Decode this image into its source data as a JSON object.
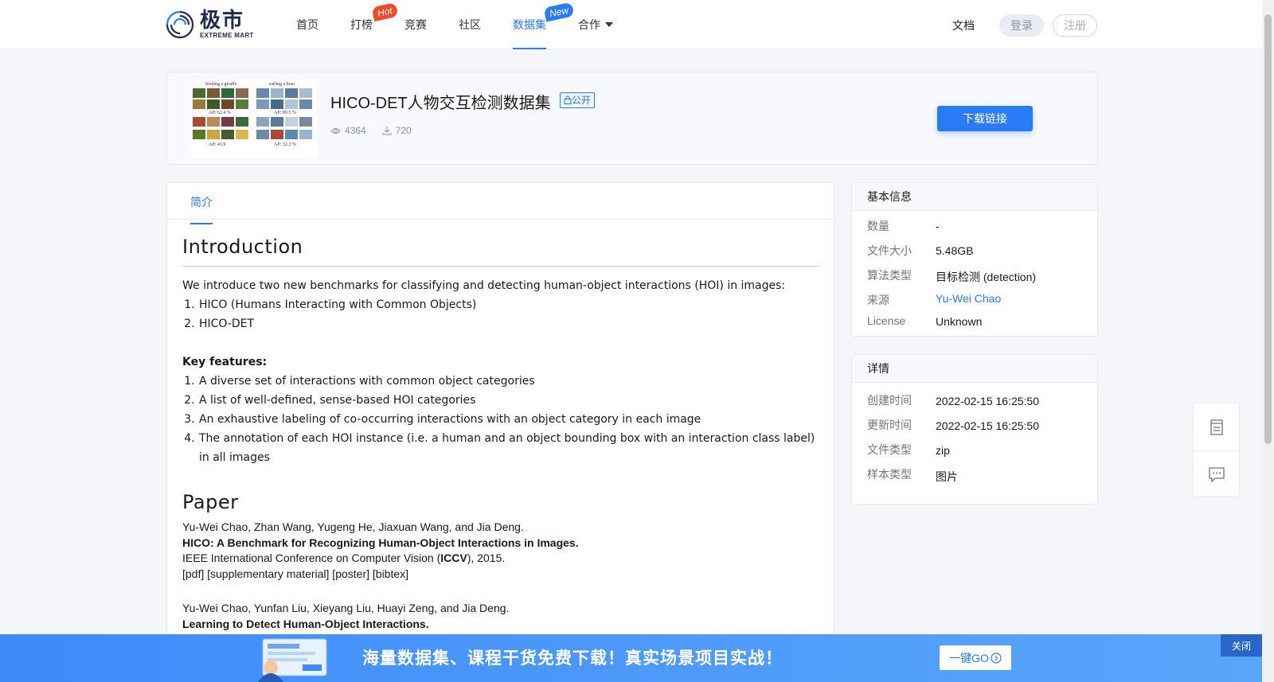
{
  "brand": {
    "name_cn": "极市",
    "name_en": "EXTREME MART"
  },
  "nav": {
    "items": [
      {
        "label": "首页"
      },
      {
        "label": "打榜",
        "badge": "Hot"
      },
      {
        "label": "竞赛"
      },
      {
        "label": "社区"
      },
      {
        "label": "数据集",
        "badge": "New",
        "active": true
      },
      {
        "label": "合作"
      }
    ],
    "docs": "文档",
    "login": "登录",
    "register": "注册"
  },
  "dataset": {
    "title": "HICO-DET人物交互检测数据集",
    "visibility": "公开",
    "views": "4364",
    "downloads": "720",
    "download_button": "下载链接",
    "thumbnail_captions": [
      "feeding a giraffe",
      "sailing a boat",
      "AP: 62.4 %",
      "AP: 89.5 %",
      "AP: 43.9",
      "AP: 32.2 %"
    ]
  },
  "tabs": [
    {
      "label": "简介"
    }
  ],
  "content": {
    "intro_heading": "Introduction",
    "intro_text": "We introduce two new benchmarks for classifying and detecting human-object interactions (HOI) in images:",
    "benchmarks": [
      "HICO (Humans Interacting with Common Objects)",
      "HICO-DET"
    ],
    "key_features_label": "Key features:",
    "key_features": [
      "A diverse set of interactions with common object categories",
      "A list of well-defined, sense-based HOI categories",
      "An exhaustive labeling of co-occurring interactions with an object category in each image",
      "The annotation of each HOI instance (i.e. a human and an object bounding box with an interaction class label) in all images"
    ],
    "paper_heading": "Paper",
    "papers": [
      {
        "authors": "Yu-Wei Chao, Zhan Wang, Yugeng He, Jiaxuan Wang, and Jia Deng.",
        "title": "HICO: A Benchmark for Recognizing Human-Object Interactions in Images.",
        "venue_prefix": "IEEE International Conference on Computer Vision (",
        "venue_abbr": "ICCV",
        "venue_suffix": "), 2015.",
        "links": "[pdf] [supplementary material] [poster] [bibtex]"
      },
      {
        "authors": "Yu-Wei Chao, Yunfan Liu, Xieyang Liu, Huayi Zeng, and Jia Deng.",
        "title": "Learning to Detect Human-Object Interactions."
      }
    ]
  },
  "basic_info": {
    "heading": "基本信息",
    "rows": [
      {
        "key": "数量",
        "value": "-"
      },
      {
        "key": "文件大小",
        "value": "5.48GB"
      },
      {
        "key": "算法类型",
        "value": "目标检测 (detection)"
      },
      {
        "key": "来源",
        "value": "Yu-Wei Chao"
      },
      {
        "key": "License",
        "value": "Unknown"
      }
    ]
  },
  "details": {
    "heading": "详情",
    "rows": [
      {
        "key": "创建时间",
        "value": "2022-02-15 16:25:50"
      },
      {
        "key": "更新时间",
        "value": "2022-02-15 16:25:50"
      },
      {
        "key": "文件类型",
        "value": "zip"
      },
      {
        "key": "样本类型",
        "value": "图片"
      }
    ]
  },
  "banner": {
    "text": "海量数据集、课程干货免费下载！真实场景项目实战！",
    "go_button": "一键GO",
    "close_button": "关闭"
  },
  "colors": {
    "accent": "#2a7bf6",
    "hot_badge": "#f04a2a",
    "banner": "#4f9cfb"
  },
  "icons": [
    "eye-icon",
    "download-icon",
    "lock-icon",
    "caret-down-icon",
    "document-icon",
    "comment-icon",
    "arrow-circle-icon"
  ]
}
